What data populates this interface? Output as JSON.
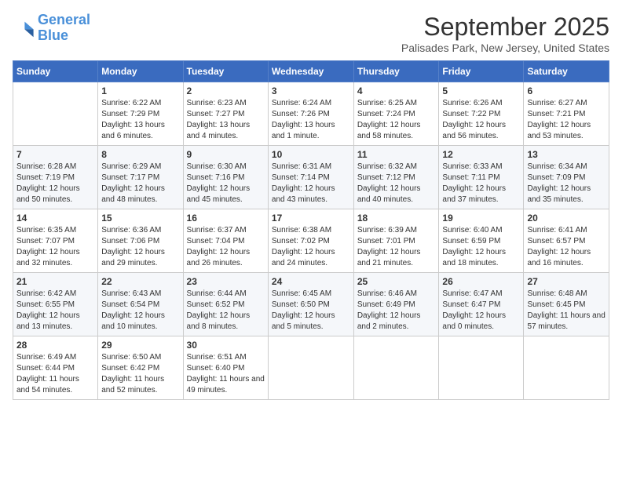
{
  "logo": {
    "line1": "General",
    "line2": "Blue"
  },
  "header": {
    "month": "September 2025",
    "location": "Palisades Park, New Jersey, United States"
  },
  "days_of_week": [
    "Sunday",
    "Monday",
    "Tuesday",
    "Wednesday",
    "Thursday",
    "Friday",
    "Saturday"
  ],
  "weeks": [
    [
      {
        "day": "",
        "sunrise": "",
        "sunset": "",
        "daylight": ""
      },
      {
        "day": "1",
        "sunrise": "Sunrise: 6:22 AM",
        "sunset": "Sunset: 7:29 PM",
        "daylight": "Daylight: 13 hours and 6 minutes."
      },
      {
        "day": "2",
        "sunrise": "Sunrise: 6:23 AM",
        "sunset": "Sunset: 7:27 PM",
        "daylight": "Daylight: 13 hours and 4 minutes."
      },
      {
        "day": "3",
        "sunrise": "Sunrise: 6:24 AM",
        "sunset": "Sunset: 7:26 PM",
        "daylight": "Daylight: 13 hours and 1 minute."
      },
      {
        "day": "4",
        "sunrise": "Sunrise: 6:25 AM",
        "sunset": "Sunset: 7:24 PM",
        "daylight": "Daylight: 12 hours and 58 minutes."
      },
      {
        "day": "5",
        "sunrise": "Sunrise: 6:26 AM",
        "sunset": "Sunset: 7:22 PM",
        "daylight": "Daylight: 12 hours and 56 minutes."
      },
      {
        "day": "6",
        "sunrise": "Sunrise: 6:27 AM",
        "sunset": "Sunset: 7:21 PM",
        "daylight": "Daylight: 12 hours and 53 minutes."
      }
    ],
    [
      {
        "day": "7",
        "sunrise": "Sunrise: 6:28 AM",
        "sunset": "Sunset: 7:19 PM",
        "daylight": "Daylight: 12 hours and 50 minutes."
      },
      {
        "day": "8",
        "sunrise": "Sunrise: 6:29 AM",
        "sunset": "Sunset: 7:17 PM",
        "daylight": "Daylight: 12 hours and 48 minutes."
      },
      {
        "day": "9",
        "sunrise": "Sunrise: 6:30 AM",
        "sunset": "Sunset: 7:16 PM",
        "daylight": "Daylight: 12 hours and 45 minutes."
      },
      {
        "day": "10",
        "sunrise": "Sunrise: 6:31 AM",
        "sunset": "Sunset: 7:14 PM",
        "daylight": "Daylight: 12 hours and 43 minutes."
      },
      {
        "day": "11",
        "sunrise": "Sunrise: 6:32 AM",
        "sunset": "Sunset: 7:12 PM",
        "daylight": "Daylight: 12 hours and 40 minutes."
      },
      {
        "day": "12",
        "sunrise": "Sunrise: 6:33 AM",
        "sunset": "Sunset: 7:11 PM",
        "daylight": "Daylight: 12 hours and 37 minutes."
      },
      {
        "day": "13",
        "sunrise": "Sunrise: 6:34 AM",
        "sunset": "Sunset: 7:09 PM",
        "daylight": "Daylight: 12 hours and 35 minutes."
      }
    ],
    [
      {
        "day": "14",
        "sunrise": "Sunrise: 6:35 AM",
        "sunset": "Sunset: 7:07 PM",
        "daylight": "Daylight: 12 hours and 32 minutes."
      },
      {
        "day": "15",
        "sunrise": "Sunrise: 6:36 AM",
        "sunset": "Sunset: 7:06 PM",
        "daylight": "Daylight: 12 hours and 29 minutes."
      },
      {
        "day": "16",
        "sunrise": "Sunrise: 6:37 AM",
        "sunset": "Sunset: 7:04 PM",
        "daylight": "Daylight: 12 hours and 26 minutes."
      },
      {
        "day": "17",
        "sunrise": "Sunrise: 6:38 AM",
        "sunset": "Sunset: 7:02 PM",
        "daylight": "Daylight: 12 hours and 24 minutes."
      },
      {
        "day": "18",
        "sunrise": "Sunrise: 6:39 AM",
        "sunset": "Sunset: 7:01 PM",
        "daylight": "Daylight: 12 hours and 21 minutes."
      },
      {
        "day": "19",
        "sunrise": "Sunrise: 6:40 AM",
        "sunset": "Sunset: 6:59 PM",
        "daylight": "Daylight: 12 hours and 18 minutes."
      },
      {
        "day": "20",
        "sunrise": "Sunrise: 6:41 AM",
        "sunset": "Sunset: 6:57 PM",
        "daylight": "Daylight: 12 hours and 16 minutes."
      }
    ],
    [
      {
        "day": "21",
        "sunrise": "Sunrise: 6:42 AM",
        "sunset": "Sunset: 6:55 PM",
        "daylight": "Daylight: 12 hours and 13 minutes."
      },
      {
        "day": "22",
        "sunrise": "Sunrise: 6:43 AM",
        "sunset": "Sunset: 6:54 PM",
        "daylight": "Daylight: 12 hours and 10 minutes."
      },
      {
        "day": "23",
        "sunrise": "Sunrise: 6:44 AM",
        "sunset": "Sunset: 6:52 PM",
        "daylight": "Daylight: 12 hours and 8 minutes."
      },
      {
        "day": "24",
        "sunrise": "Sunrise: 6:45 AM",
        "sunset": "Sunset: 6:50 PM",
        "daylight": "Daylight: 12 hours and 5 minutes."
      },
      {
        "day": "25",
        "sunrise": "Sunrise: 6:46 AM",
        "sunset": "Sunset: 6:49 PM",
        "daylight": "Daylight: 12 hours and 2 minutes."
      },
      {
        "day": "26",
        "sunrise": "Sunrise: 6:47 AM",
        "sunset": "Sunset: 6:47 PM",
        "daylight": "Daylight: 12 hours and 0 minutes."
      },
      {
        "day": "27",
        "sunrise": "Sunrise: 6:48 AM",
        "sunset": "Sunset: 6:45 PM",
        "daylight": "Daylight: 11 hours and 57 minutes."
      }
    ],
    [
      {
        "day": "28",
        "sunrise": "Sunrise: 6:49 AM",
        "sunset": "Sunset: 6:44 PM",
        "daylight": "Daylight: 11 hours and 54 minutes."
      },
      {
        "day": "29",
        "sunrise": "Sunrise: 6:50 AM",
        "sunset": "Sunset: 6:42 PM",
        "daylight": "Daylight: 11 hours and 52 minutes."
      },
      {
        "day": "30",
        "sunrise": "Sunrise: 6:51 AM",
        "sunset": "Sunset: 6:40 PM",
        "daylight": "Daylight: 11 hours and 49 minutes."
      },
      {
        "day": "",
        "sunrise": "",
        "sunset": "",
        "daylight": ""
      },
      {
        "day": "",
        "sunrise": "",
        "sunset": "",
        "daylight": ""
      },
      {
        "day": "",
        "sunrise": "",
        "sunset": "",
        "daylight": ""
      },
      {
        "day": "",
        "sunrise": "",
        "sunset": "",
        "daylight": ""
      }
    ]
  ]
}
